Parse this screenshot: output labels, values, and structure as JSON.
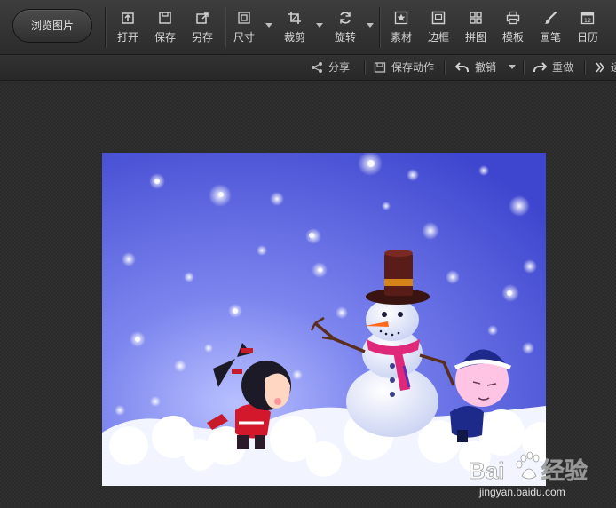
{
  "toolbar": {
    "browse_label": "浏览图片",
    "tools": [
      {
        "label": "打开",
        "icon": "open-icon"
      },
      {
        "label": "保存",
        "icon": "save-icon"
      },
      {
        "label": "另存",
        "icon": "save-as-icon"
      },
      {
        "label": "尺寸",
        "icon": "resize-icon"
      },
      {
        "label": "裁剪",
        "icon": "crop-icon"
      },
      {
        "label": "旋转",
        "icon": "rotate-icon"
      },
      {
        "label": "素材",
        "icon": "material-star-icon"
      },
      {
        "label": "边框",
        "icon": "frame-icon"
      },
      {
        "label": "拼图",
        "icon": "collage-icon"
      },
      {
        "label": "模板",
        "icon": "template-printer-icon"
      },
      {
        "label": "画笔",
        "icon": "brush-icon"
      },
      {
        "label": "日历",
        "icon": "calendar-icon"
      }
    ],
    "calendar_day": "12"
  },
  "actionbar": {
    "share": "分享",
    "save_action": "保存动作",
    "undo": "撤销",
    "redo": "重做",
    "more_partial": "运"
  },
  "image": {
    "subject": "snowman and two cartoon children in falling snow",
    "watermark_logo": "Baidu",
    "watermark_suffix": "经验",
    "watermark_url": "jingyan.baidu.com"
  },
  "colors": {
    "toolbar_bg": "#333333",
    "canvas_bg": "#2a2a2a",
    "sky": "#5a63d8",
    "snow": "#ffffff"
  }
}
